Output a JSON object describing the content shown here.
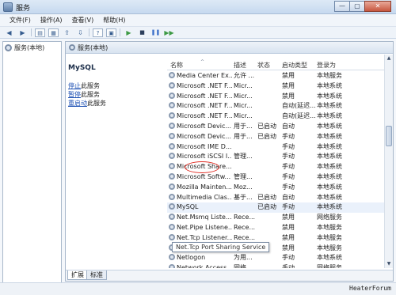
{
  "window": {
    "title": "服务",
    "buttons": [
      "—",
      "▢",
      "✕"
    ]
  },
  "menu": [
    "文件(F)",
    "操作(A)",
    "查看(V)",
    "帮助(H)"
  ],
  "toolbar": [
    "◀",
    "▶",
    "▤",
    "▦",
    "⇪",
    "⇩",
    "?",
    "▣",
    "▶",
    "■",
    "❚❚",
    "▶▶"
  ],
  "tree": {
    "root_label": "服务(本地)"
  },
  "main_header": "服务(本地)",
  "details": {
    "service_name": "MySQL",
    "actions": [
      {
        "link": "停止",
        "suffix": "此服务"
      },
      {
        "link": "暂停",
        "suffix": "此服务"
      },
      {
        "link": "重启动",
        "suffix": "此服务"
      }
    ]
  },
  "columns": [
    "名称",
    "描述",
    "状态",
    "启动类型",
    "登录为"
  ],
  "rows": [
    {
      "name": "Media Center Ex...",
      "desc": "允许 ...",
      "state": "",
      "start": "禁用",
      "login": "本地服务"
    },
    {
      "name": "Microsoft .NET F...",
      "desc": "Micr...",
      "state": "",
      "start": "禁用",
      "login": "本地系统"
    },
    {
      "name": "Microsoft .NET F...",
      "desc": "Micr...",
      "state": "",
      "start": "禁用",
      "login": "本地系统"
    },
    {
      "name": "Microsoft .NET F...",
      "desc": "Micr...",
      "state": "",
      "start": "自动(延迟...",
      "login": "本地系统"
    },
    {
      "name": "Microsoft .NET F...",
      "desc": "Micr...",
      "state": "",
      "start": "自动(延迟...",
      "login": "本地系统"
    },
    {
      "name": "Microsoft Devic...",
      "desc": "用于...",
      "state": "已启动",
      "start": "自动",
      "login": "本地系统"
    },
    {
      "name": "Microsoft Devic...",
      "desc": "用于...",
      "state": "已启动",
      "start": "手动",
      "login": "本地系统"
    },
    {
      "name": "Microsoft IME D...",
      "desc": "",
      "state": "",
      "start": "手动",
      "login": "本地系统"
    },
    {
      "name": "Microsoft iSCSI I...",
      "desc": "管理...",
      "state": "",
      "start": "手动",
      "login": "本地系统"
    },
    {
      "name": "Microsoft Share...",
      "desc": "",
      "state": "",
      "start": "手动",
      "login": "本地系统"
    },
    {
      "name": "Microsoft Softw...",
      "desc": "管理...",
      "state": "",
      "start": "手动",
      "login": "本地系统"
    },
    {
      "name": "Mozilla Mainten...",
      "desc": "Moz...",
      "state": "",
      "start": "手动",
      "login": "本地系统"
    },
    {
      "name": "Multimedia Clas...",
      "desc": "基于...",
      "state": "已启动",
      "start": "自动",
      "login": "本地系统"
    },
    {
      "name": "MySQL",
      "desc": "",
      "state": "已启动",
      "start": "手动",
      "login": "本地系统",
      "selected": true
    },
    {
      "name": "Net.Msmq Liste...",
      "desc": "Rece...",
      "state": "",
      "start": "禁用",
      "login": "网络服务"
    },
    {
      "name": "Net.Pipe Listene...",
      "desc": "Rece...",
      "state": "",
      "start": "禁用",
      "login": "本地服务"
    },
    {
      "name": "Net.Tcp Listener...",
      "desc": "Rece...",
      "state": "",
      "start": "禁用",
      "login": "本地服务"
    },
    {
      "name": "",
      "desc": "",
      "state": "",
      "start": "禁用",
      "login": "本地服务"
    },
    {
      "name": "Netlogon",
      "desc": "为用...",
      "state": "",
      "start": "手动",
      "login": "本地系统"
    },
    {
      "name": "Network Access...",
      "desc": "网络...",
      "state": "",
      "start": "手动",
      "login": "网络服务"
    }
  ],
  "tooltip": "Net.Tcp Port Sharing Service",
  "tabs": [
    "扩展",
    "标准"
  ],
  "watermark": "HeaterForum"
}
